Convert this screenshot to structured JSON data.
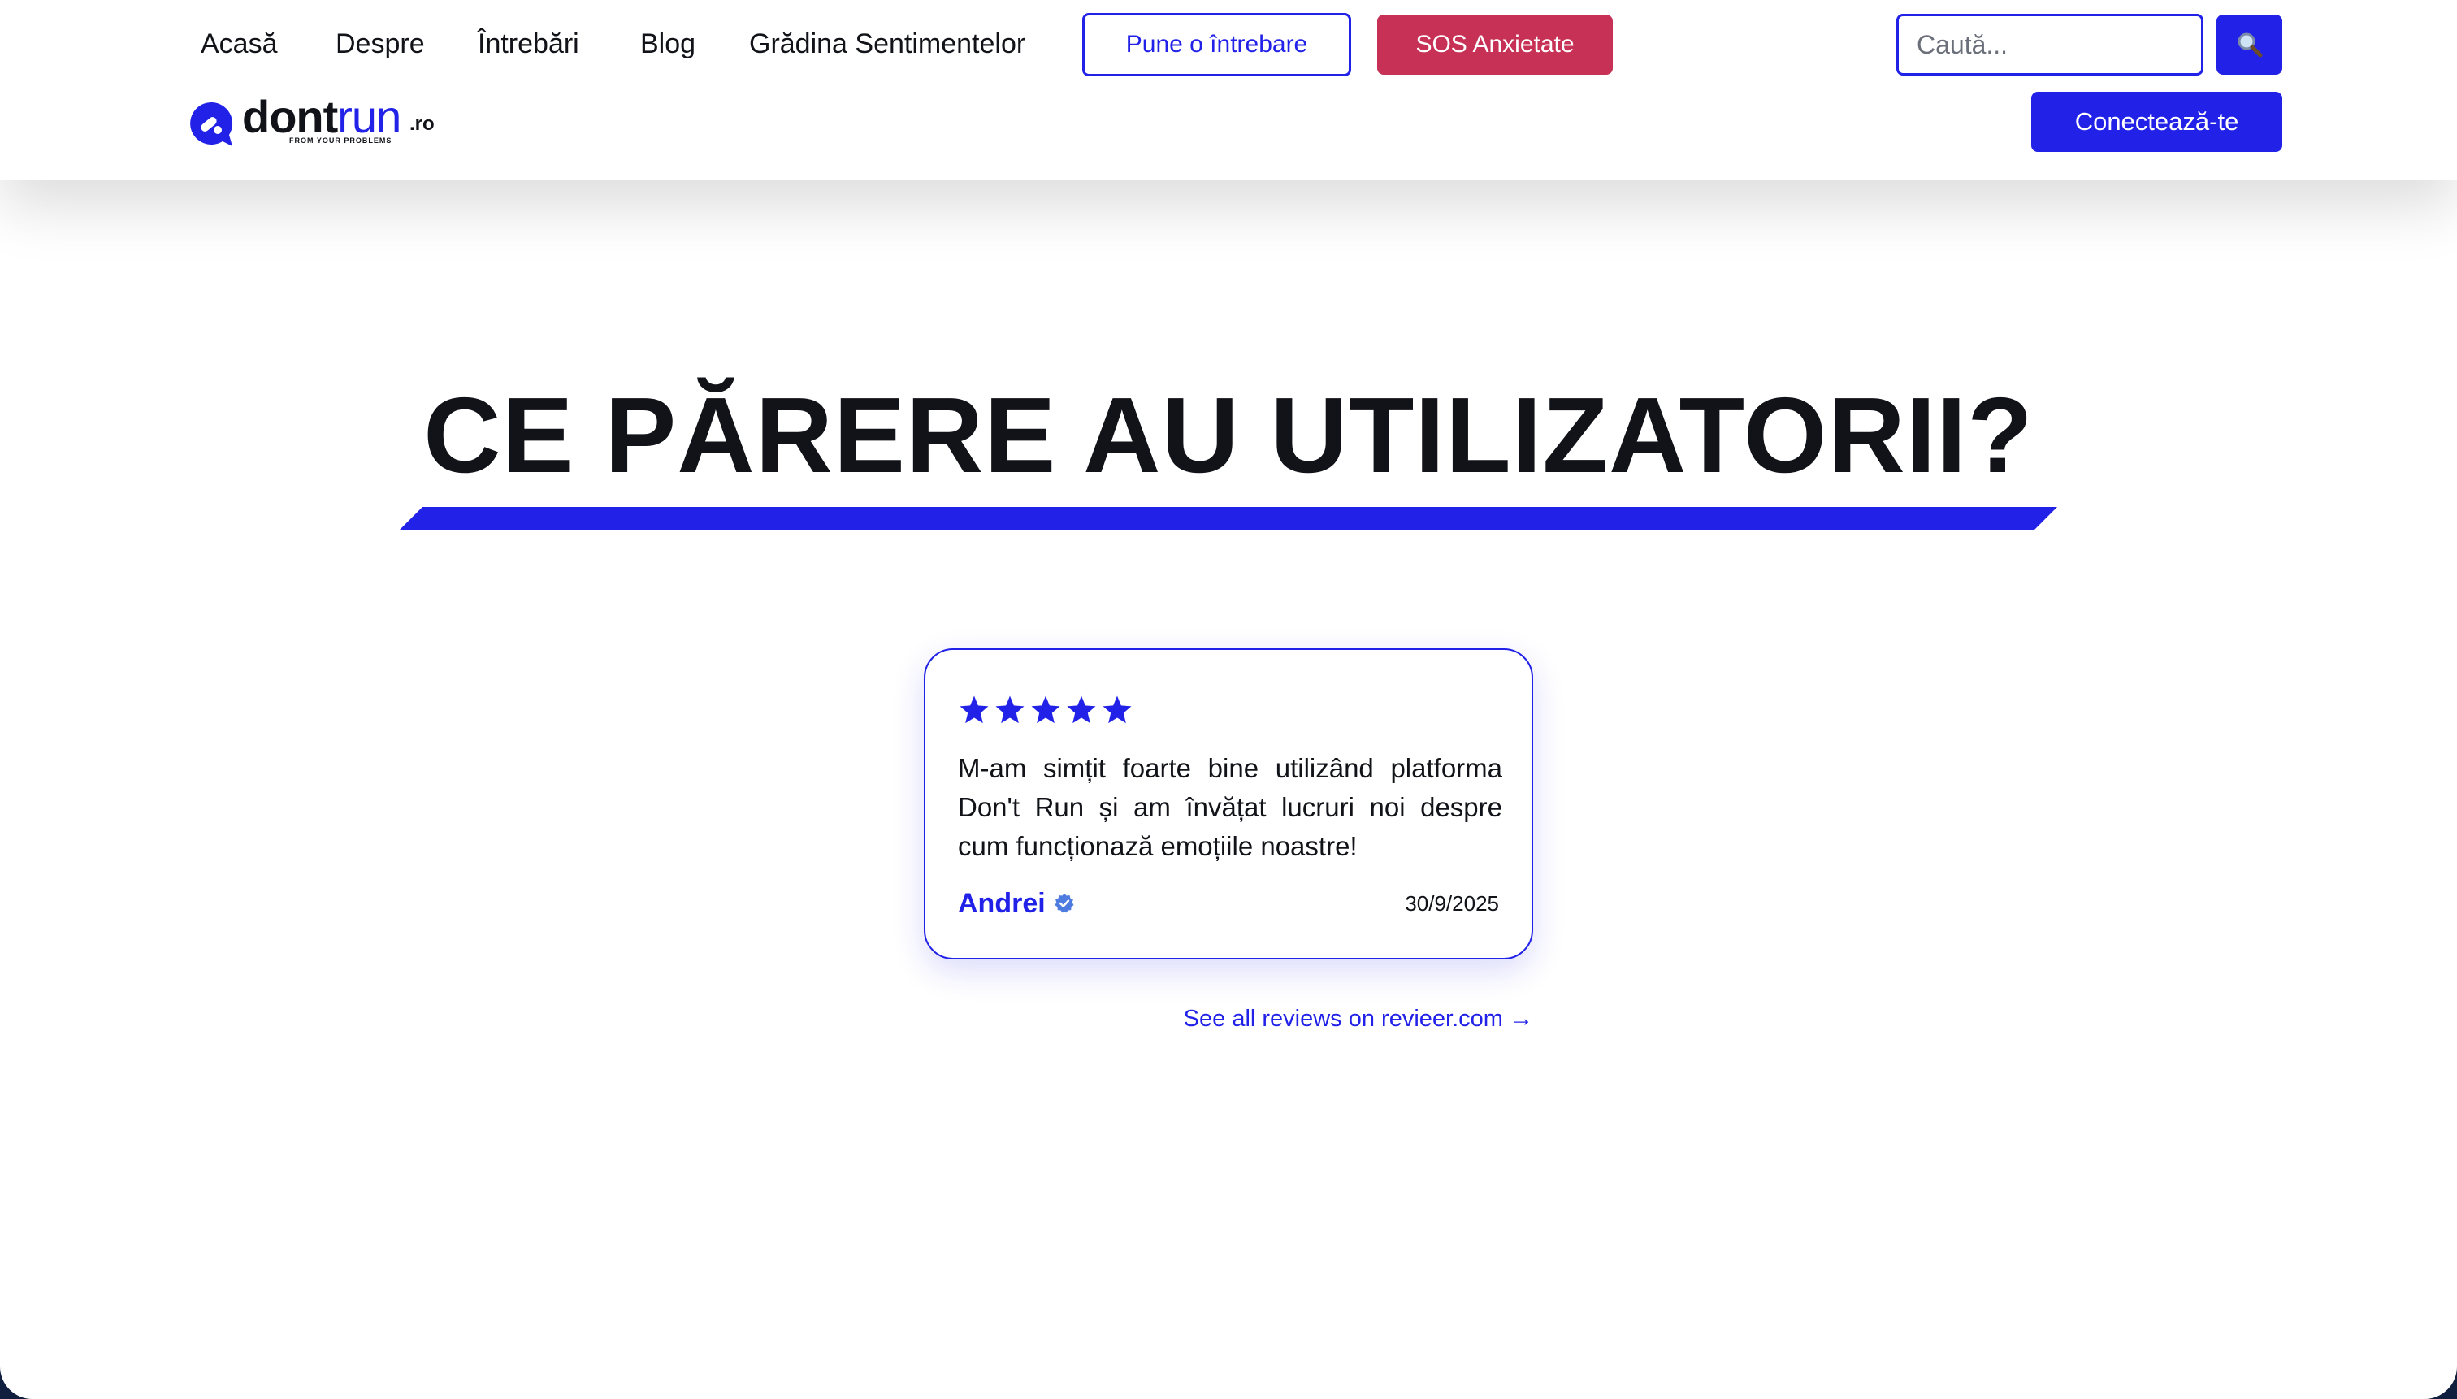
{
  "nav": {
    "items": [
      {
        "label": "Acasă"
      },
      {
        "label": "Despre"
      },
      {
        "label": "Întrebări"
      },
      {
        "label": "Blog"
      },
      {
        "label": "Grădina Sentimentelor"
      }
    ],
    "ask_label": "Pune o întrebare",
    "sos_label": "SOS Anxietate",
    "search_placeholder": "Caută...",
    "search_icon": "magnifier-icon",
    "connect_label": "Conectează-te"
  },
  "logo": {
    "word_bold": "dont",
    "word_light": "run",
    "tld": ".ro",
    "tagline": "FROM YOUR PROBLEMS"
  },
  "section": {
    "title": "CE PĂRERE AU UTILIZATORII?"
  },
  "review": {
    "rating": 5,
    "rating_max": 5,
    "text": "M-am simțit foarte bine utilizând platforma Don't Run și am învățat lucruri noi despre cum funcționază emoțiile noastre!",
    "author": "Andrei",
    "verified_icon": "verified-badge-icon",
    "date": "30/9/2025"
  },
  "all_reviews_link": "See all reviews on revieer.com →",
  "colors": {
    "accent": "#2121e8",
    "sos": "#c73156",
    "text": "#111318",
    "verified": "#4d7be0"
  }
}
